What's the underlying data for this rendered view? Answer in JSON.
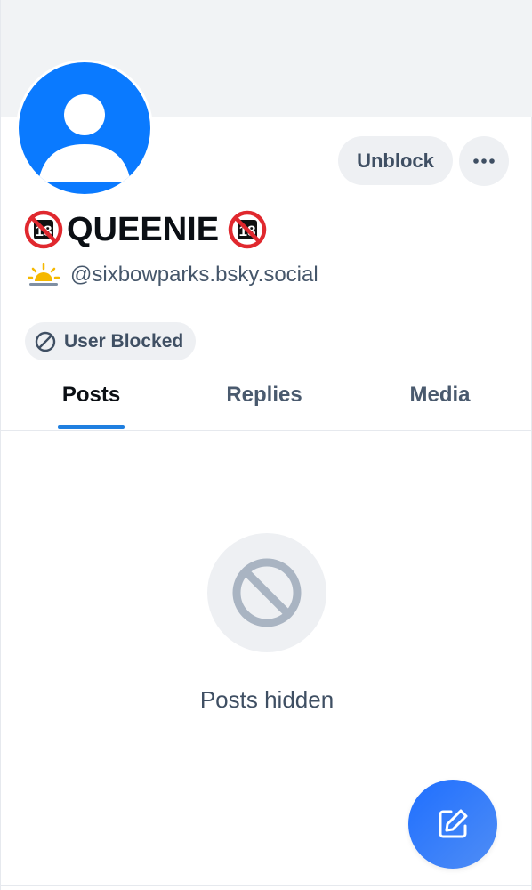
{
  "profile": {
    "display_name": "QUEENIE",
    "handle": "@sixbowparks.bsky.social",
    "name_badge_icon": "no-under-18-icon",
    "handle_icon": "sun-behind-cloud-icon"
  },
  "actions": {
    "unblock_label": "Unblock",
    "more_icon": "ellipsis-icon"
  },
  "status": {
    "blocked_label": "User Blocked",
    "blocked_icon": "block-icon"
  },
  "tabs": [
    {
      "label": "Posts",
      "active": true
    },
    {
      "label": "Replies",
      "active": false
    },
    {
      "label": "Media",
      "active": false
    }
  ],
  "feed": {
    "empty_message": "Posts hidden",
    "empty_icon": "block-icon"
  },
  "fab": {
    "icon": "compose-icon"
  },
  "colors": {
    "accent": "#1f7fe0",
    "avatar_bg": "#0a7aff",
    "fab_start": "#1f6fff",
    "fab_end": "#4f8df5",
    "muted_text": "#3f4f63",
    "pill_bg": "#eef0f3"
  }
}
